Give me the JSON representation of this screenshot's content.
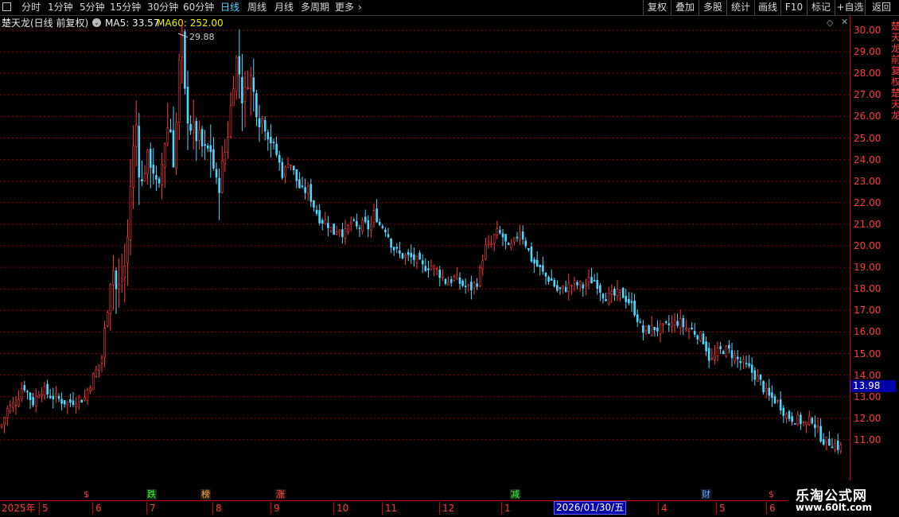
{
  "toolbar": {
    "periods": [
      {
        "label": "分时",
        "active": false
      },
      {
        "label": "1分钟",
        "active": false
      },
      {
        "label": "5分钟",
        "active": false
      },
      {
        "label": "15分钟",
        "active": false
      },
      {
        "label": "30分钟",
        "active": false
      },
      {
        "label": "60分钟",
        "active": false
      },
      {
        "label": "日线",
        "active": true
      },
      {
        "label": "周线",
        "active": false
      },
      {
        "label": "月线",
        "active": false
      },
      {
        "label": "多周期",
        "active": false
      },
      {
        "label": "更多",
        "active": false
      }
    ],
    "more_arrow": "›",
    "right_buttons": [
      "复权",
      "叠加",
      "多股",
      "统计",
      "画线",
      "F10",
      "标记",
      "+自选",
      "返回"
    ]
  },
  "info": {
    "stock_name": "楚天龙(日线 前复权)",
    "ma5": "MA5: 33.57",
    "ma60": "MA60: 252.00"
  },
  "price_axis": {
    "labels": [
      "30.00",
      "29.00",
      "28.00",
      "27.00",
      "26.00",
      "25.00",
      "24.00",
      "23.00",
      "22.00",
      "21.00",
      "20.00",
      "19.00",
      "18.00",
      "17.00",
      "16.00",
      "15.00",
      "14.00",
      "13.00",
      "12.00",
      "11.00"
    ],
    "current_price": "13.98"
  },
  "peak_label": "29.88",
  "events": [
    {
      "text": "$",
      "color": "#ff3b3b",
      "bg": "transparent"
    },
    {
      "text": "跌",
      "color": "#33ff33",
      "bg": "#1a2a1a"
    },
    {
      "text": "榜",
      "color": "#ffb040",
      "bg": "#2a2010"
    },
    {
      "text": "涨",
      "color": "#ff5555",
      "bg": "#2a1010"
    },
    {
      "text": "减",
      "color": "#33ff33",
      "bg": "#1a2a1a"
    },
    {
      "text": "财",
      "color": "#66aaff",
      "bg": "#10182a"
    },
    {
      "text": "$",
      "color": "#ff3b3b",
      "bg": "transparent"
    }
  ],
  "dates": [
    "2025年",
    "5",
    "6",
    "7",
    "8",
    "9",
    "10",
    "11",
    "12",
    "1",
    "3",
    "4",
    "5",
    "6"
  ],
  "date_cursor": "2026/01/30/五",
  "watermark": {
    "title": "乐淘公式网",
    "url": "www.60lt.com"
  },
  "colors": {
    "up": "#ff3b3b",
    "down": "#4fd8ff",
    "bg": "#000000",
    "grid": "#8b0000",
    "ma5": "#f0f0f0",
    "ma60": "#f0f000",
    "cursor_bg": "#0000a8"
  },
  "chart_data": {
    "type": "candlestick",
    "ylim": [
      10.5,
      30.3
    ],
    "grid": true,
    "price_path": [
      [
        0,
        11.6
      ],
      [
        8,
        12.4
      ],
      [
        20,
        12.8
      ],
      [
        28,
        13.6
      ],
      [
        40,
        12.7
      ],
      [
        50,
        13.4
      ],
      [
        60,
        13.1
      ],
      [
        72,
        12.9
      ],
      [
        85,
        12.7
      ],
      [
        95,
        12.9
      ],
      [
        105,
        12.9
      ],
      [
        112,
        13.6
      ],
      [
        120,
        14.2
      ],
      [
        128,
        14.9
      ],
      [
        134,
        17.3
      ],
      [
        140,
        19.3
      ],
      [
        146,
        17.7
      ],
      [
        152,
        18.5
      ],
      [
        158,
        19.4
      ],
      [
        164,
        23.5
      ],
      [
        170,
        25.7
      ],
      [
        176,
        22.5
      ],
      [
        182,
        23.9
      ],
      [
        190,
        24.0
      ],
      [
        198,
        22.1
      ],
      [
        205,
        24.7
      ],
      [
        212,
        25.9
      ],
      [
        218,
        23.7
      ],
      [
        224,
        28.3
      ],
      [
        228,
        29.6
      ],
      [
        232,
        26.5
      ],
      [
        240,
        25.4
      ],
      [
        248,
        25.0
      ],
      [
        256,
        24.3
      ],
      [
        264,
        24.5
      ],
      [
        272,
        22.5
      ],
      [
        280,
        23.9
      ],
      [
        288,
        26.0
      ],
      [
        295,
        28.8
      ],
      [
        300,
        28.0
      ],
      [
        305,
        26.5
      ],
      [
        312,
        28.2
      ],
      [
        318,
        27.0
      ],
      [
        325,
        26.0
      ],
      [
        332,
        25.8
      ],
      [
        340,
        24.9
      ],
      [
        348,
        24.1
      ],
      [
        355,
        23.2
      ],
      [
        362,
        24.1
      ],
      [
        370,
        23.2
      ],
      [
        378,
        22.5
      ],
      [
        386,
        22.6
      ],
      [
        395,
        21.7
      ],
      [
        402,
        21.2
      ],
      [
        410,
        21.1
      ],
      [
        418,
        20.6
      ],
      [
        425,
        20.9
      ],
      [
        432,
        20.5
      ],
      [
        440,
        21.1
      ],
      [
        448,
        20.8
      ],
      [
        456,
        21.0
      ],
      [
        464,
        20.8
      ],
      [
        470,
        21.6
      ],
      [
        476,
        21.0
      ],
      [
        484,
        20.8
      ],
      [
        492,
        20.0
      ],
      [
        500,
        19.6
      ],
      [
        510,
        19.5
      ],
      [
        520,
        19.4
      ],
      [
        530,
        19.0
      ],
      [
        540,
        19.1
      ],
      [
        550,
        18.8
      ],
      [
        560,
        18.3
      ],
      [
        570,
        18.5
      ],
      [
        580,
        18.2
      ],
      [
        590,
        18.0
      ],
      [
        600,
        18.4
      ],
      [
        608,
        19.9
      ],
      [
        616,
        20.0
      ],
      [
        622,
        20.6
      ],
      [
        630,
        20.5
      ],
      [
        638,
        19.8
      ],
      [
        645,
        20.1
      ],
      [
        652,
        20.8
      ],
      [
        660,
        20.1
      ],
      [
        668,
        19.3
      ],
      [
        676,
        19.0
      ],
      [
        684,
        18.6
      ],
      [
        692,
        18.4
      ],
      [
        700,
        17.9
      ],
      [
        708,
        18.0
      ],
      [
        716,
        18.2
      ],
      [
        724,
        18.2
      ],
      [
        732,
        18.1
      ],
      [
        740,
        18.4
      ],
      [
        748,
        18.4
      ],
      [
        756,
        17.8
      ],
      [
        764,
        17.6
      ],
      [
        772,
        17.7
      ],
      [
        780,
        17.8
      ],
      [
        790,
        17.4
      ],
      [
        798,
        16.9
      ],
      [
        806,
        16.0
      ],
      [
        814,
        16.1
      ],
      [
        822,
        16.2
      ],
      [
        830,
        16.1
      ],
      [
        838,
        16.3
      ],
      [
        846,
        16.4
      ],
      [
        852,
        16.5
      ],
      [
        860,
        16.2
      ],
      [
        868,
        16.1
      ],
      [
        876,
        15.9
      ],
      [
        884,
        15.6
      ],
      [
        892,
        14.6
      ],
      [
        900,
        15.0
      ],
      [
        908,
        15.2
      ],
      [
        916,
        15.1
      ],
      [
        924,
        14.8
      ],
      [
        932,
        14.5
      ],
      [
        940,
        14.3
      ],
      [
        948,
        14.0
      ],
      [
        956,
        13.6
      ],
      [
        964,
        13.0
      ],
      [
        972,
        12.9
      ],
      [
        980,
        12.6
      ],
      [
        988,
        12.1
      ],
      [
        996,
        12.0
      ],
      [
        1004,
        11.9
      ],
      [
        1012,
        11.7
      ],
      [
        1020,
        12.0
      ],
      [
        1028,
        11.3
      ],
      [
        1036,
        10.9
      ],
      [
        1044,
        10.9
      ],
      [
        1052,
        10.7
      ],
      [
        1058,
        10.6
      ]
    ]
  }
}
